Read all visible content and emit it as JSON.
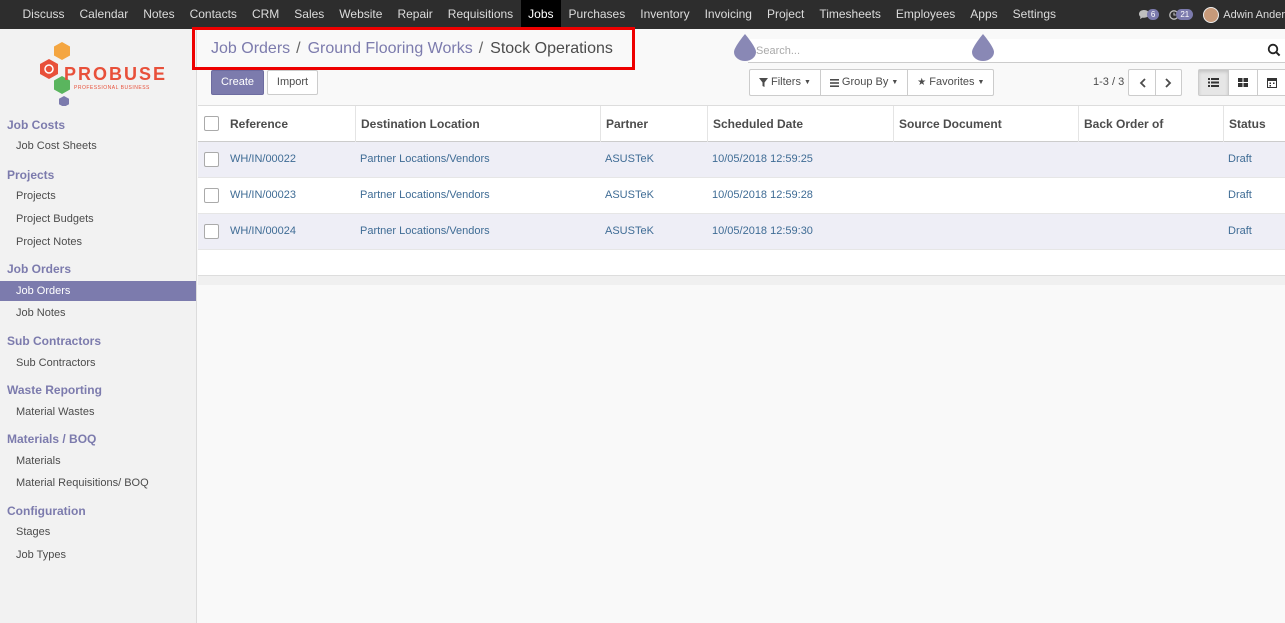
{
  "topbar": {
    "menu": [
      "Discuss",
      "Calendar",
      "Notes",
      "Contacts",
      "CRM",
      "Sales",
      "Website",
      "Repair",
      "Requisitions",
      "Jobs",
      "Purchases",
      "Inventory",
      "Invoicing",
      "Project",
      "Timesheets",
      "Employees",
      "Apps",
      "Settings"
    ],
    "active_item": "Jobs",
    "chat_badge": "6",
    "activity_badge": "21",
    "user_name": "Adwin Ander"
  },
  "logo": {
    "text": "PROBUSE",
    "subtext": "PROFESSIONAL BUSINESS"
  },
  "sidebar": {
    "sections": [
      {
        "title": "Job Costs",
        "items": [
          "Job Cost Sheets"
        ]
      },
      {
        "title": "Projects",
        "items": [
          "Projects",
          "Project Budgets",
          "Project Notes"
        ]
      },
      {
        "title": "Job Orders",
        "items": [
          "Job Orders",
          "Job Notes"
        ]
      },
      {
        "title": "Sub Contractors",
        "items": [
          "Sub Contractors"
        ]
      },
      {
        "title": "Waste Reporting",
        "items": [
          "Material Wastes"
        ]
      },
      {
        "title": "Materials / BOQ",
        "items": [
          "Materials",
          "Material Requisitions/ BOQ"
        ]
      },
      {
        "title": "Configuration",
        "items": [
          "Stages",
          "Job Types"
        ]
      }
    ],
    "active_item": "Job Orders"
  },
  "breadcrumb": {
    "items": [
      "Job Orders",
      "Ground Flooring Works",
      "Stock Operations"
    ],
    "separator": "/"
  },
  "search": {
    "placeholder": "Search..."
  },
  "buttons": {
    "create": "Create",
    "import": "Import"
  },
  "filters": {
    "filters_label": "Filters",
    "group_by_label": "Group By",
    "favorites_label": "Favorites"
  },
  "pager": {
    "value": "1-3 / 3"
  },
  "table": {
    "columns": [
      "Reference",
      "Destination Location",
      "Partner",
      "Scheduled Date",
      "Source Document",
      "Back Order of",
      "Status"
    ],
    "rows": [
      {
        "reference": "WH/IN/00022",
        "destination": "Partner Locations/Vendors",
        "partner": "ASUSTeK",
        "scheduled_date": "10/05/2018 12:59:25",
        "source_document": "",
        "back_order_of": "",
        "status": "Draft"
      },
      {
        "reference": "WH/IN/00023",
        "destination": "Partner Locations/Vendors",
        "partner": "ASUSTeK",
        "scheduled_date": "10/05/2018 12:59:28",
        "source_document": "",
        "back_order_of": "",
        "status": "Draft"
      },
      {
        "reference": "WH/IN/00024",
        "destination": "Partner Locations/Vendors",
        "partner": "ASUSTeK",
        "scheduled_date": "10/05/2018 12:59:30",
        "source_document": "",
        "back_order_of": "",
        "status": "Draft"
      }
    ]
  },
  "colors": {
    "brand": "#7c7bad",
    "topbar": "#2d2d2d",
    "link": "#3f6c95",
    "highlight": "#e00000"
  }
}
